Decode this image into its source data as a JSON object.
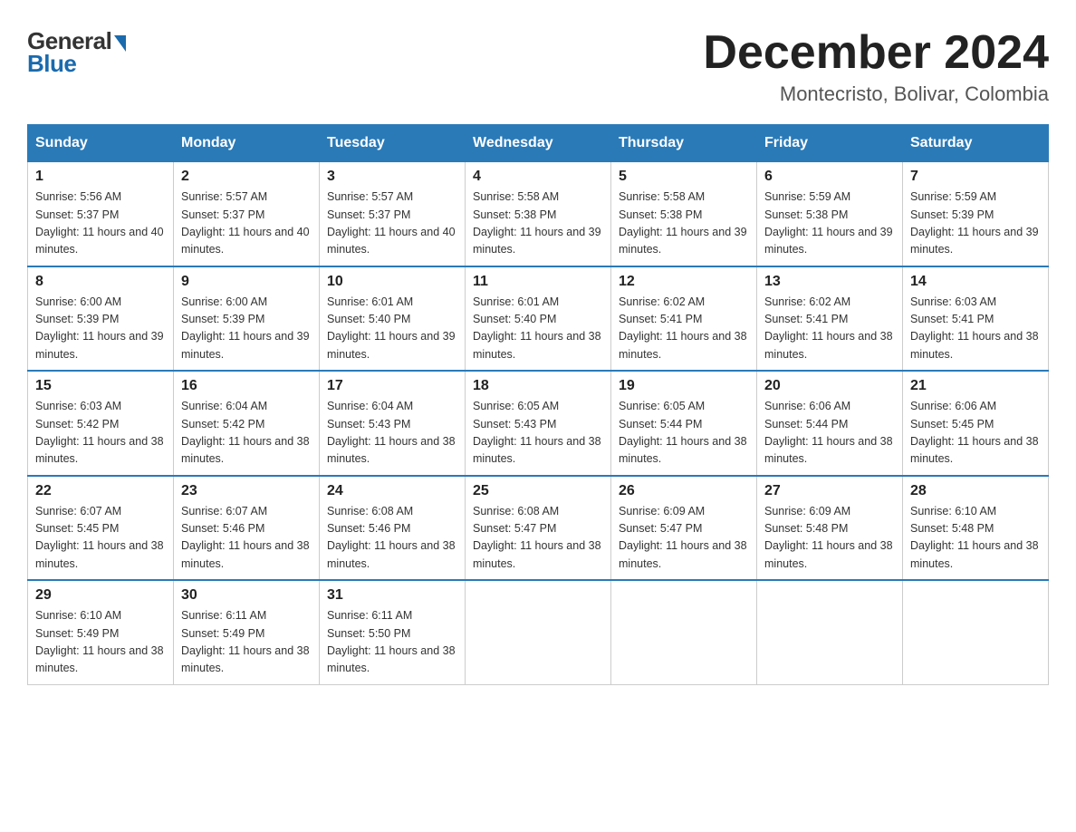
{
  "logo": {
    "general": "General",
    "blue": "Blue"
  },
  "title": "December 2024",
  "location": "Montecristo, Bolivar, Colombia",
  "days_of_week": [
    "Sunday",
    "Monday",
    "Tuesday",
    "Wednesday",
    "Thursday",
    "Friday",
    "Saturday"
  ],
  "weeks": [
    [
      {
        "day": "1",
        "sunrise": "Sunrise: 5:56 AM",
        "sunset": "Sunset: 5:37 PM",
        "daylight": "Daylight: 11 hours and 40 minutes."
      },
      {
        "day": "2",
        "sunrise": "Sunrise: 5:57 AM",
        "sunset": "Sunset: 5:37 PM",
        "daylight": "Daylight: 11 hours and 40 minutes."
      },
      {
        "day": "3",
        "sunrise": "Sunrise: 5:57 AM",
        "sunset": "Sunset: 5:37 PM",
        "daylight": "Daylight: 11 hours and 40 minutes."
      },
      {
        "day": "4",
        "sunrise": "Sunrise: 5:58 AM",
        "sunset": "Sunset: 5:38 PM",
        "daylight": "Daylight: 11 hours and 39 minutes."
      },
      {
        "day": "5",
        "sunrise": "Sunrise: 5:58 AM",
        "sunset": "Sunset: 5:38 PM",
        "daylight": "Daylight: 11 hours and 39 minutes."
      },
      {
        "day": "6",
        "sunrise": "Sunrise: 5:59 AM",
        "sunset": "Sunset: 5:38 PM",
        "daylight": "Daylight: 11 hours and 39 minutes."
      },
      {
        "day": "7",
        "sunrise": "Sunrise: 5:59 AM",
        "sunset": "Sunset: 5:39 PM",
        "daylight": "Daylight: 11 hours and 39 minutes."
      }
    ],
    [
      {
        "day": "8",
        "sunrise": "Sunrise: 6:00 AM",
        "sunset": "Sunset: 5:39 PM",
        "daylight": "Daylight: 11 hours and 39 minutes."
      },
      {
        "day": "9",
        "sunrise": "Sunrise: 6:00 AM",
        "sunset": "Sunset: 5:39 PM",
        "daylight": "Daylight: 11 hours and 39 minutes."
      },
      {
        "day": "10",
        "sunrise": "Sunrise: 6:01 AM",
        "sunset": "Sunset: 5:40 PM",
        "daylight": "Daylight: 11 hours and 39 minutes."
      },
      {
        "day": "11",
        "sunrise": "Sunrise: 6:01 AM",
        "sunset": "Sunset: 5:40 PM",
        "daylight": "Daylight: 11 hours and 38 minutes."
      },
      {
        "day": "12",
        "sunrise": "Sunrise: 6:02 AM",
        "sunset": "Sunset: 5:41 PM",
        "daylight": "Daylight: 11 hours and 38 minutes."
      },
      {
        "day": "13",
        "sunrise": "Sunrise: 6:02 AM",
        "sunset": "Sunset: 5:41 PM",
        "daylight": "Daylight: 11 hours and 38 minutes."
      },
      {
        "day": "14",
        "sunrise": "Sunrise: 6:03 AM",
        "sunset": "Sunset: 5:41 PM",
        "daylight": "Daylight: 11 hours and 38 minutes."
      }
    ],
    [
      {
        "day": "15",
        "sunrise": "Sunrise: 6:03 AM",
        "sunset": "Sunset: 5:42 PM",
        "daylight": "Daylight: 11 hours and 38 minutes."
      },
      {
        "day": "16",
        "sunrise": "Sunrise: 6:04 AM",
        "sunset": "Sunset: 5:42 PM",
        "daylight": "Daylight: 11 hours and 38 minutes."
      },
      {
        "day": "17",
        "sunrise": "Sunrise: 6:04 AM",
        "sunset": "Sunset: 5:43 PM",
        "daylight": "Daylight: 11 hours and 38 minutes."
      },
      {
        "day": "18",
        "sunrise": "Sunrise: 6:05 AM",
        "sunset": "Sunset: 5:43 PM",
        "daylight": "Daylight: 11 hours and 38 minutes."
      },
      {
        "day": "19",
        "sunrise": "Sunrise: 6:05 AM",
        "sunset": "Sunset: 5:44 PM",
        "daylight": "Daylight: 11 hours and 38 minutes."
      },
      {
        "day": "20",
        "sunrise": "Sunrise: 6:06 AM",
        "sunset": "Sunset: 5:44 PM",
        "daylight": "Daylight: 11 hours and 38 minutes."
      },
      {
        "day": "21",
        "sunrise": "Sunrise: 6:06 AM",
        "sunset": "Sunset: 5:45 PM",
        "daylight": "Daylight: 11 hours and 38 minutes."
      }
    ],
    [
      {
        "day": "22",
        "sunrise": "Sunrise: 6:07 AM",
        "sunset": "Sunset: 5:45 PM",
        "daylight": "Daylight: 11 hours and 38 minutes."
      },
      {
        "day": "23",
        "sunrise": "Sunrise: 6:07 AM",
        "sunset": "Sunset: 5:46 PM",
        "daylight": "Daylight: 11 hours and 38 minutes."
      },
      {
        "day": "24",
        "sunrise": "Sunrise: 6:08 AM",
        "sunset": "Sunset: 5:46 PM",
        "daylight": "Daylight: 11 hours and 38 minutes."
      },
      {
        "day": "25",
        "sunrise": "Sunrise: 6:08 AM",
        "sunset": "Sunset: 5:47 PM",
        "daylight": "Daylight: 11 hours and 38 minutes."
      },
      {
        "day": "26",
        "sunrise": "Sunrise: 6:09 AM",
        "sunset": "Sunset: 5:47 PM",
        "daylight": "Daylight: 11 hours and 38 minutes."
      },
      {
        "day": "27",
        "sunrise": "Sunrise: 6:09 AM",
        "sunset": "Sunset: 5:48 PM",
        "daylight": "Daylight: 11 hours and 38 minutes."
      },
      {
        "day": "28",
        "sunrise": "Sunrise: 6:10 AM",
        "sunset": "Sunset: 5:48 PM",
        "daylight": "Daylight: 11 hours and 38 minutes."
      }
    ],
    [
      {
        "day": "29",
        "sunrise": "Sunrise: 6:10 AM",
        "sunset": "Sunset: 5:49 PM",
        "daylight": "Daylight: 11 hours and 38 minutes."
      },
      {
        "day": "30",
        "sunrise": "Sunrise: 6:11 AM",
        "sunset": "Sunset: 5:49 PM",
        "daylight": "Daylight: 11 hours and 38 minutes."
      },
      {
        "day": "31",
        "sunrise": "Sunrise: 6:11 AM",
        "sunset": "Sunset: 5:50 PM",
        "daylight": "Daylight: 11 hours and 38 minutes."
      },
      null,
      null,
      null,
      null
    ]
  ]
}
